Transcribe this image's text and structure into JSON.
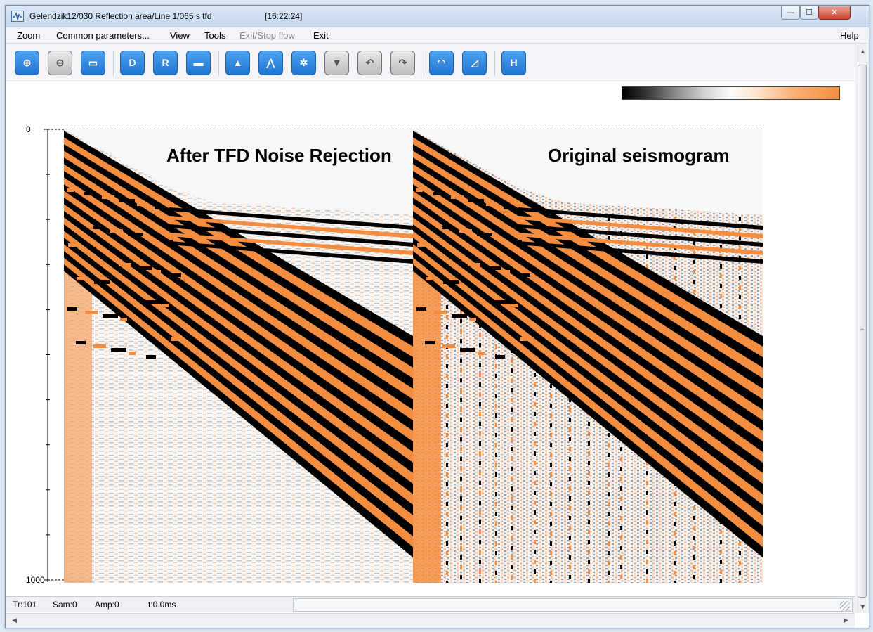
{
  "window": {
    "title": "Gelendzik12/030 Reflection area/Line 1/065 s tfd",
    "time": "[16:22:24]",
    "controls": {
      "minimize": "—",
      "maximize": "☐",
      "close": "✕"
    }
  },
  "menu": {
    "zoom": "Zoom",
    "common_parameters": "Common parameters...",
    "view": "View",
    "tools": "Tools",
    "exit_stop_flow": "Exit/Stop flow",
    "exit": "Exit",
    "help": "Help"
  },
  "toolbar": {
    "buttons": [
      {
        "icon": "zoom-in-icon",
        "glyph": "⊕"
      },
      {
        "icon": "zoom-out-icon",
        "glyph": "⊖"
      },
      {
        "icon": "zoom-fit-icon",
        "glyph": "▭"
      },
      {
        "icon": "display-d-icon",
        "glyph": "D"
      },
      {
        "icon": "display-r-icon",
        "glyph": "R"
      },
      {
        "icon": "toggle-icon",
        "glyph": "▬"
      },
      {
        "icon": "gain-db-up-icon",
        "glyph": "▲"
      },
      {
        "icon": "pick-line-icon",
        "glyph": "⋀"
      },
      {
        "icon": "settings-gear-icon",
        "glyph": "✲"
      },
      {
        "icon": "gain-db-down-icon",
        "glyph": "▼"
      },
      {
        "icon": "undo-icon",
        "glyph": "↶"
      },
      {
        "icon": "redo-icon",
        "glyph": "↷"
      },
      {
        "icon": "spectrum-icon",
        "glyph": "◠"
      },
      {
        "icon": "filter-icon",
        "glyph": "◿"
      },
      {
        "icon": "header-h-icon",
        "glyph": "H"
      }
    ]
  },
  "colors": {
    "positive": "#f48d3f",
    "negative": "#000000",
    "background": "#ffffff",
    "accent": "#1e74d0"
  },
  "plot": {
    "panels": [
      {
        "label": "After TFD Noise Rejection"
      },
      {
        "label": "Original seismogram"
      }
    ],
    "time_axis": {
      "unit": "ms",
      "min": 0,
      "max": 1000,
      "ticks": [
        "0",
        "1000"
      ]
    }
  },
  "status": {
    "trace": "Tr:101",
    "sample": "Sam:0",
    "amplitude": "Amp:0",
    "time": "t:0.0ms"
  },
  "scroll": {
    "up": "▲",
    "down": "▼",
    "left": "◀",
    "right": "▶",
    "grip": "≡"
  }
}
